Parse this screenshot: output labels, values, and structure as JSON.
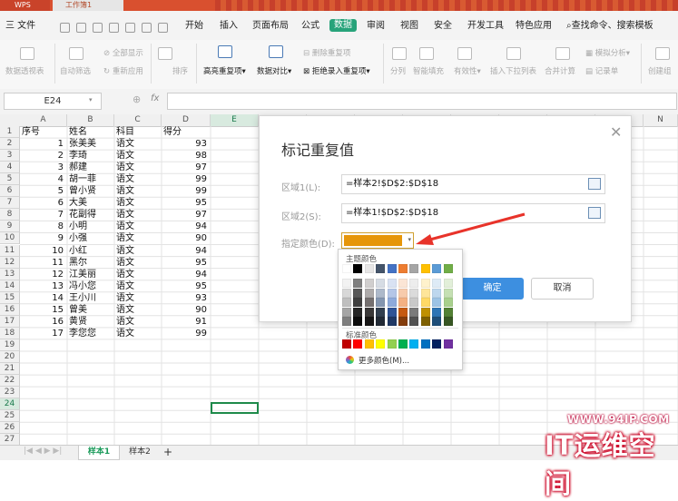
{
  "titlebar": {
    "app": "WPS",
    "book": "工作簿1"
  },
  "menubar": {
    "file": "三 文件",
    "items": [
      "开始",
      "插入",
      "页面布局",
      "公式",
      "数据",
      "审阅",
      "视图",
      "安全",
      "开发工具",
      "特色应用"
    ],
    "active": "数据",
    "search": "查找命令、搜索模板"
  },
  "ribbon": {
    "pivot": "数据透视表",
    "autofilter": "自动筛选",
    "show_all": "全部显示",
    "reapply": "重新应用",
    "sort": "排序",
    "highlight_dup": "高亮重复项",
    "data_compare": "数据对比",
    "delete_dup": "删除重复项",
    "reject_dup": "拒绝录入重复项",
    "split": "分列",
    "smart_fill": "智能填充",
    "validity": "有效性",
    "insert_dropdown": "插入下拉列表",
    "consolidate": "合并计算",
    "simulate": "模拟分析",
    "record": "记录单",
    "create_group": "创建组"
  },
  "formula": {
    "namebox": "E24",
    "fx": "fx"
  },
  "grid": {
    "cols": [
      "A",
      "B",
      "C",
      "D",
      "E",
      "F",
      "G",
      "H",
      "I",
      "J",
      "K",
      "L",
      "M",
      "N"
    ],
    "rows": [
      "1",
      "2",
      "3",
      "4",
      "5",
      "6",
      "7",
      "8",
      "9",
      "10",
      "11",
      "12",
      "13",
      "14",
      "15",
      "16",
      "17",
      "18",
      "19",
      "20",
      "21",
      "22",
      "23",
      "24",
      "25",
      "26",
      "27"
    ],
    "header": [
      "序号",
      "姓名",
      "科目",
      "得分"
    ],
    "data": [
      [
        "1",
        "张美美",
        "语文",
        "93"
      ],
      [
        "2",
        "李琦",
        "语文",
        "98"
      ],
      [
        "3",
        "郝建",
        "语文",
        "97"
      ],
      [
        "4",
        "胡一菲",
        "语文",
        "99"
      ],
      [
        "5",
        "曾小贤",
        "语文",
        "99"
      ],
      [
        "6",
        "大美",
        "语文",
        "95"
      ],
      [
        "7",
        "花副得",
        "语文",
        "97"
      ],
      [
        "8",
        "小明",
        "语文",
        "94"
      ],
      [
        "9",
        "小强",
        "语文",
        "90"
      ],
      [
        "10",
        "小红",
        "语文",
        "94"
      ],
      [
        "11",
        "黑尔",
        "语文",
        "95"
      ],
      [
        "12",
        "江美丽",
        "语文",
        "94"
      ],
      [
        "13",
        "冯小您",
        "语文",
        "95"
      ],
      [
        "14",
        "王小川",
        "语文",
        "93"
      ],
      [
        "15",
        "曾美",
        "语文",
        "90"
      ],
      [
        "16",
        "黄贤",
        "语文",
        "91"
      ],
      [
        "17",
        "李您您",
        "语文",
        "99"
      ]
    ]
  },
  "sheets": [
    "样本1",
    "样本2",
    "+"
  ],
  "dialog": {
    "title": "标记重复值",
    "range1_label": "区域1(L):",
    "range1_value": "=样本2!$D$2:$D$18",
    "range2_label": "区域2(S):",
    "range2_value": "=样本1!$D$2:$D$18",
    "color_label": "指定颜色(D):",
    "selected_color": "#e6960a",
    "ok": "确定",
    "cancel": "取消"
  },
  "palette": {
    "theme_title": "主题颜色",
    "standard_title": "标准颜色",
    "more": "更多颜色(M)...",
    "theme_top": [
      "#ffffff",
      "#000000",
      "#e7e6e6",
      "#44546a",
      "#4472c4",
      "#ed7d31",
      "#a5a5a5",
      "#ffc000",
      "#5b9bd5",
      "#70ad47"
    ],
    "theme_shades": [
      [
        "#f2f2f2",
        "#7f7f7f",
        "#d0cece",
        "#d6dce4",
        "#d9e2f3",
        "#fbe5d5",
        "#ededed",
        "#fff2cc",
        "#deebf6",
        "#e2efd9"
      ],
      [
        "#d8d8d8",
        "#595959",
        "#aeabab",
        "#adb9ca",
        "#b4c6e7",
        "#f7cbac",
        "#dbdbdb",
        "#fee599",
        "#bdd7ee",
        "#c5e0b3"
      ],
      [
        "#bfbfbf",
        "#3f3f3f",
        "#757070",
        "#8496b0",
        "#8eaadb",
        "#f4b183",
        "#c9c9c9",
        "#ffd965",
        "#9cc3e5",
        "#a8d08d"
      ],
      [
        "#a5a5a5",
        "#262626",
        "#3a3838",
        "#323f4f",
        "#2f5496",
        "#c55a11",
        "#7b7b7b",
        "#bf9000",
        "#2e75b5",
        "#538135"
      ],
      [
        "#7f7f7f",
        "#0c0c0c",
        "#171616",
        "#222a35",
        "#1f3864",
        "#833c0b",
        "#525252",
        "#7f6000",
        "#1e4e79",
        "#375623"
      ]
    ],
    "standard": [
      "#c00000",
      "#ff0000",
      "#ffc000",
      "#ffff00",
      "#92d050",
      "#00b050",
      "#00b0f0",
      "#0070c0",
      "#002060",
      "#7030a0"
    ]
  },
  "watermark": {
    "url": "WWW.94IP.COM",
    "name": "IT运维空间"
  }
}
